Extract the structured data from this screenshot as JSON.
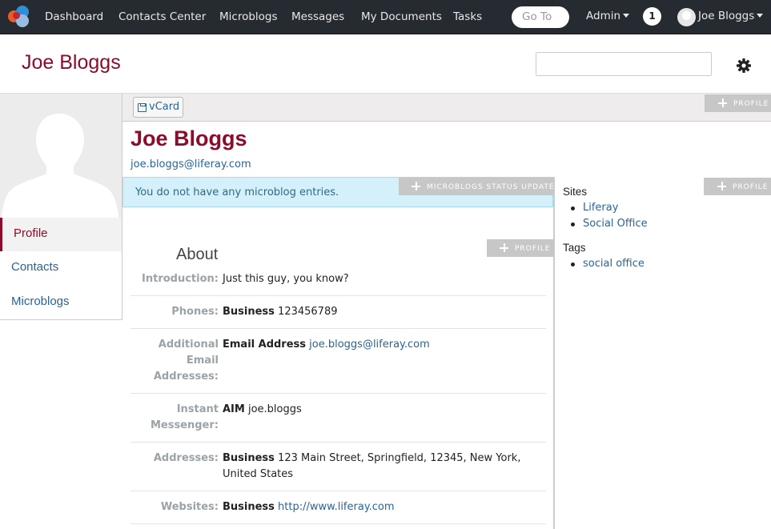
{
  "dockbar": {
    "nav": [
      "Dashboard",
      "Contacts Center",
      "Microblogs",
      "Messages",
      "My Documents",
      "Tasks"
    ],
    "goto_placeholder": "Go To",
    "admin_label": "Admin",
    "notification_count": "1",
    "user_name": "Joe Bloggs"
  },
  "header": {
    "site_title": "Joe Bloggs"
  },
  "sidebar": {
    "items": [
      {
        "label": "Profile",
        "active": true
      },
      {
        "label": "Contacts",
        "active": false
      },
      {
        "label": "Microblogs",
        "active": false
      }
    ]
  },
  "toolbar": {
    "vcard_label": "vCard",
    "profile_tab": "PROFILE"
  },
  "profile": {
    "name": "Joe Bloggs",
    "email": "joe.bloggs@liferay.com"
  },
  "microblog": {
    "message": "You do not have any microblog entries.",
    "tab": "MICROBLOGS STATUS UPDATE"
  },
  "about": {
    "title": "About",
    "tab": "PROFILE",
    "rows": [
      {
        "label": "Introduction:",
        "type": "",
        "value": "Just this guy, you know?"
      },
      {
        "label": "Phones:",
        "type": "Business",
        "value": "123456789"
      },
      {
        "label": "Additional Email Addresses:",
        "type": "Email Address",
        "value": "joe.bloggs@liferay.com"
      },
      {
        "label": "Instant Messenger:",
        "type": "AIM",
        "value": "joe.bloggs"
      },
      {
        "label": "Addresses:",
        "type": "Business",
        "value": "123 Main Street, Springfield, 12345, New York, United States"
      },
      {
        "label": "Websites:",
        "type": "Business",
        "value": "http://www.liferay.com"
      }
    ]
  },
  "right": {
    "tab": "PROFILE",
    "sites_title": "Sites",
    "sites": [
      "Liferay",
      "Social Office"
    ],
    "tags_title": "Tags",
    "tags": [
      "social office"
    ]
  },
  "colors": {
    "brand": "#8b0d2b",
    "dockbar": "#262b31",
    "link": "#2a6496",
    "info_bg": "#d4f0fa"
  }
}
